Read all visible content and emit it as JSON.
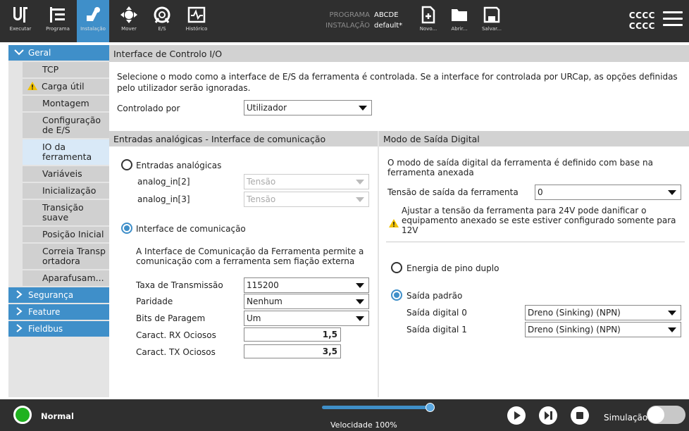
{
  "topbar": {
    "buttons": [
      {
        "label": "Executar",
        "icon": "ur-logo-icon"
      },
      {
        "label": "Programa",
        "icon": "program-icon"
      },
      {
        "label": "Instalação",
        "icon": "installation-icon"
      },
      {
        "label": "Mover",
        "icon": "move-icon"
      },
      {
        "label": "E/S",
        "icon": "io-icon"
      },
      {
        "label": "Histórico",
        "icon": "log-icon"
      }
    ],
    "program_key": "PROGRAMA",
    "program_value": "ABCDE",
    "installation_key": "INSTALAÇÃO",
    "installation_value": "default*",
    "file_buttons": [
      {
        "label": "Novo...",
        "icon": "new-file-icon"
      },
      {
        "label": "Abrir...",
        "icon": "open-folder-icon"
      },
      {
        "label": "Salvar...",
        "icon": "save-icon"
      }
    ],
    "right_line1": "CCCC",
    "right_line2": "CCCC"
  },
  "sidebar": {
    "general": "Geral",
    "items": [
      {
        "label": "TCP"
      },
      {
        "label": "Carga útil",
        "warning": true
      },
      {
        "label": "Montagem"
      },
      {
        "label": "Configuração de E/S"
      },
      {
        "label": "IO da ferramenta",
        "active": true
      },
      {
        "label": "Variáveis"
      },
      {
        "label": "Inicialização"
      },
      {
        "label": "Transição suave"
      },
      {
        "label": "Posição Inicial"
      },
      {
        "label": "Correia Transportadora"
      },
      {
        "label": "Aparafusam..."
      }
    ],
    "sections": [
      "Segurança",
      "Feature",
      "Fieldbus"
    ]
  },
  "main": {
    "title": "Interface de Controlo I/O",
    "intro": "Selecione o modo como a interface de E/S da ferramenta é controlada. Se a interface for controlada por URCap, as opções definidas pelo utilizador serão ignoradas.",
    "controlled_by_label": "Controlado por",
    "controlled_by_value": "Utilizador"
  },
  "left_panel": {
    "title": "Entradas analógicas - Interface de comunicação",
    "analog_radio": "Entradas analógicas",
    "analog_in2": "analog_in[2]",
    "analog_in3": "analog_in[3]",
    "analog_mode2": "Tensão",
    "analog_mode3": "Tensão",
    "comm_radio": "Interface de comunicação",
    "comm_desc": "A Interface de Comunicação da Ferramenta permite a comunicação com a ferramenta sem fiação externa",
    "baud_label": "Taxa de Transmissão",
    "baud_value": "115200",
    "parity_label": "Paridade",
    "parity_value": "Nenhum",
    "stop_label": "Bits de Paragem",
    "stop_value": "Um",
    "rx_label": "Caract. RX Ociosos",
    "rx_value": "1,5",
    "tx_label": "Caract. TX Ociosos",
    "tx_value": "3,5"
  },
  "right_panel": {
    "title": "Modo de Saída Digital",
    "desc": "O modo de saída digital da ferramenta é definido com base na ferramenta anexada",
    "voltage_label": "Tensão de saída da ferramenta",
    "voltage_value": "0",
    "warning": "Ajustar a tensão da ferramenta para 24V pode danificar o equipamento anexado se este estiver configurado somente para 12V",
    "dual_pin_radio": "Energia de pino duplo",
    "standard_radio": "Saída padrão",
    "do0_label": "Saída digital 0",
    "do0_value": "Dreno (Sinking) (NPN)",
    "do1_label": "Saída digital 1",
    "do1_value": "Dreno (Sinking) (NPN)"
  },
  "bottombar": {
    "status": "Normal",
    "speed": "Velocidade 100%",
    "speed_fraction": 1.0,
    "simulation": "Simulação"
  },
  "colors": {
    "accent": "#3f8fc9",
    "topbar": "#2f2f2f",
    "status_ok": "#1fb21f",
    "warning": "#f2c200"
  }
}
